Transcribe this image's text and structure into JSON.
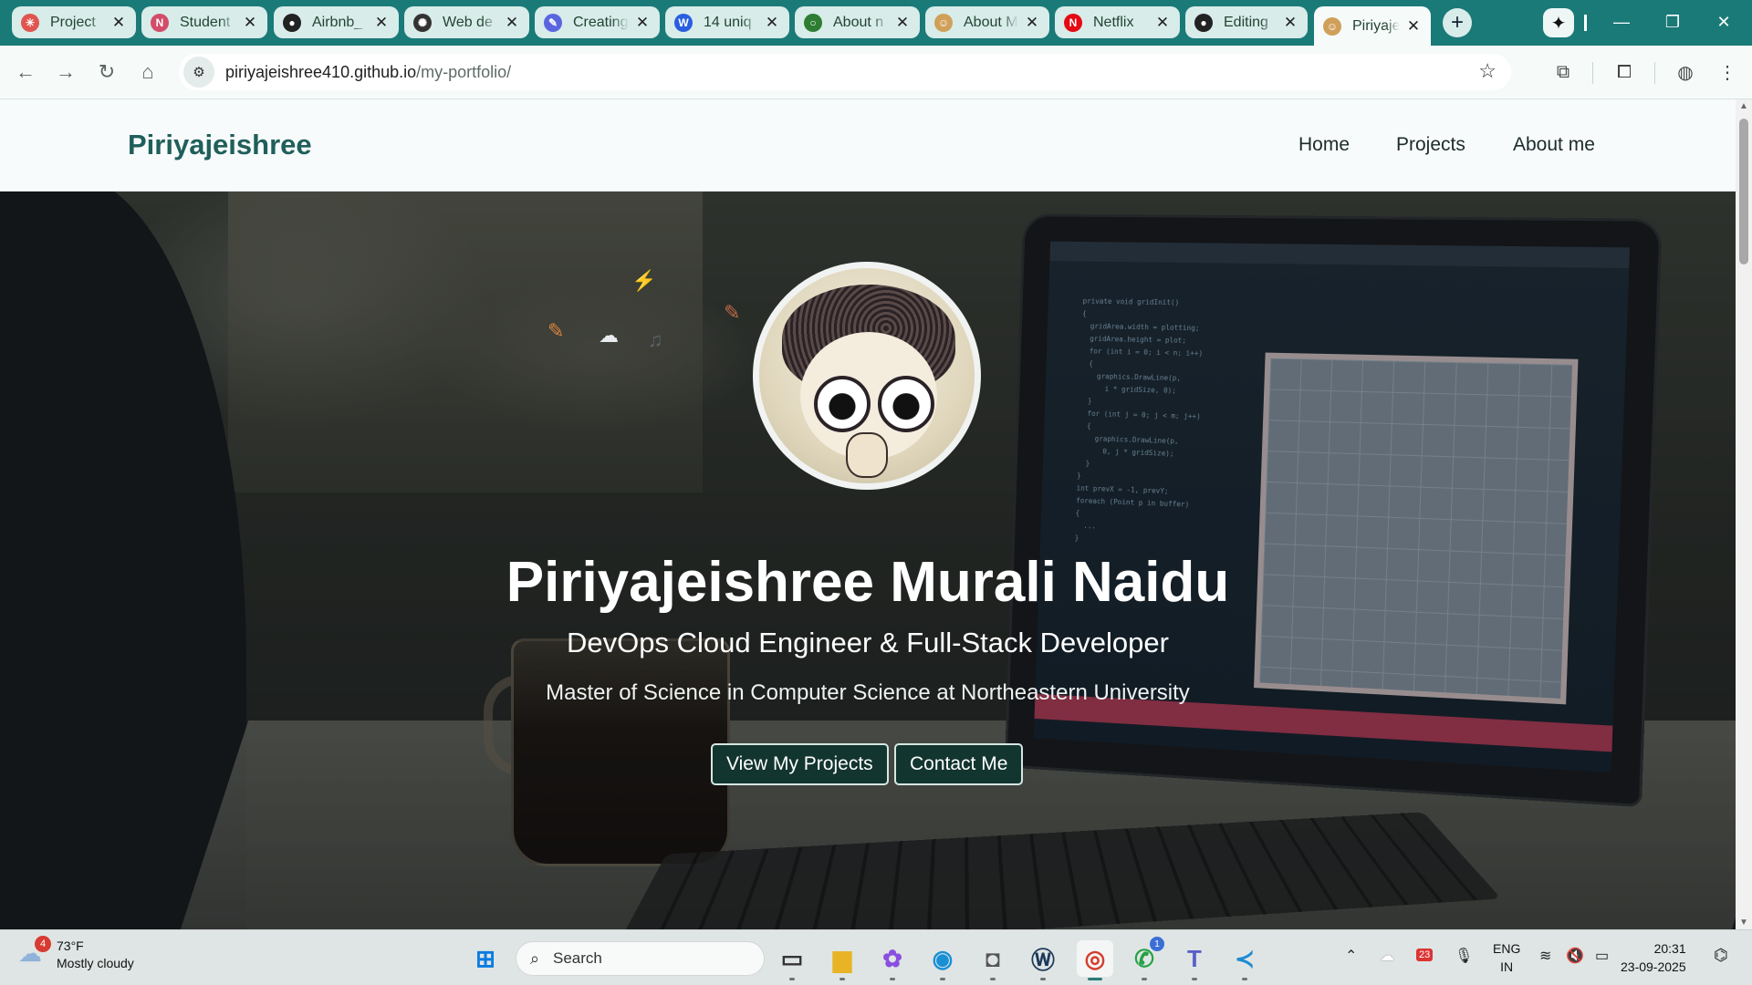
{
  "browser": {
    "tabs": [
      {
        "label": "Project",
        "icon": "asterisk-logo-icon",
        "color": "#e0554f",
        "glyph": "✳"
      },
      {
        "label": "Student",
        "icon": "notion-n-icon",
        "color": "#d34c6a",
        "glyph": "N"
      },
      {
        "label": "Airbnb_",
        "icon": "github-icon",
        "color": "#222222",
        "glyph": "●"
      },
      {
        "label": "Web de",
        "icon": "openai-icon",
        "color": "#333333",
        "glyph": "✺"
      },
      {
        "label": "Creating",
        "icon": "hook-icon",
        "color": "#5a66e0",
        "glyph": "✎"
      },
      {
        "label": "14 uniq",
        "icon": "w-logo-icon",
        "color": "#2a5ee0",
        "glyph": "W"
      },
      {
        "label": "About n",
        "icon": "circle-logo-icon",
        "color": "#2e7d32",
        "glyph": "○"
      },
      {
        "label": "About M",
        "icon": "avatar-icon",
        "color": "#d0a05a",
        "glyph": "☺"
      },
      {
        "label": "Netflix",
        "icon": "netflix-icon",
        "color": "#e50914",
        "glyph": "N"
      },
      {
        "label": "Editing",
        "icon": "github-icon",
        "color": "#222222",
        "glyph": "●"
      },
      {
        "label": "Piriyajei",
        "icon": "avatar-icon",
        "color": "#d0a05a",
        "glyph": "☺",
        "active": true
      }
    ],
    "new_tab_glyph": "+",
    "gemini_glyph": "✦",
    "window_controls": {
      "minimize": "—",
      "restore": "❐",
      "close": "✕"
    },
    "nav": {
      "back": "←",
      "forward": "→",
      "reload": "↻",
      "home": "⌂"
    },
    "url_host": "piriyajeishree410.github.io",
    "url_path": "/my-portfolio/",
    "site_info_glyph": "⚙",
    "bookmark_glyph": "☆",
    "extensions_glyph": "⧉",
    "cast_glyph": "⧠",
    "profile_glyph": "◍",
    "menu_glyph": "⋮"
  },
  "site": {
    "brand": "Piriyajeishree",
    "nav": [
      "Home",
      "Projects",
      "About me"
    ]
  },
  "hero": {
    "name": "Piriyajeishree Murali Naidu",
    "role": "DevOps Cloud Engineer & Full-Stack Developer",
    "education": "Master of Science in Computer Science at Northeastern University",
    "buttons": [
      "View My Projects",
      "Contact Me"
    ],
    "floating_icons": [
      "⚡",
      "☁",
      "♫",
      "✎",
      "✎"
    ]
  },
  "taskbar": {
    "weather": {
      "temp": "73°F",
      "condition": "Mostly cloudy",
      "badge": "4",
      "glyph": "☁"
    },
    "search_placeholder": "Search",
    "search_glyph": "⌕",
    "apps": [
      {
        "name": "start-button",
        "glyph": "⊞",
        "color": "#0a7be0"
      },
      {
        "name": "task-view-icon",
        "glyph": "▭",
        "color": "#333333"
      },
      {
        "name": "file-explorer-icon",
        "glyph": "▆",
        "color": "#e8b426"
      },
      {
        "name": "copilot-icon",
        "glyph": "✿",
        "color": "#8a4fe0"
      },
      {
        "name": "edge-icon",
        "glyph": "◉",
        "color": "#1a8fd6"
      },
      {
        "name": "camera-icon",
        "glyph": "◘",
        "color": "#555555"
      },
      {
        "name": "wordpress-icon",
        "glyph": "Ⓦ",
        "color": "#1d3a5a"
      },
      {
        "name": "chrome-icon",
        "glyph": "◎",
        "color": "#d63d2e",
        "active": true
      },
      {
        "name": "whatsapp-icon",
        "glyph": "✆",
        "color": "#25a244",
        "badge": "1"
      },
      {
        "name": "teams-icon",
        "glyph": "T",
        "color": "#5b5fc7"
      },
      {
        "name": "vscode-icon",
        "glyph": "≺",
        "color": "#1f8ad2"
      }
    ],
    "tray": {
      "chevron": "⌃",
      "onedrive": "☁",
      "calendar_badge": "23",
      "mic": "🎙",
      "wifi": "≋",
      "volume": "🔇",
      "battery": "▭"
    },
    "language": {
      "line1": "ENG",
      "line2": "IN"
    },
    "time": "20:31",
    "date": "23-09-2025",
    "notification_glyph": "⌬"
  }
}
